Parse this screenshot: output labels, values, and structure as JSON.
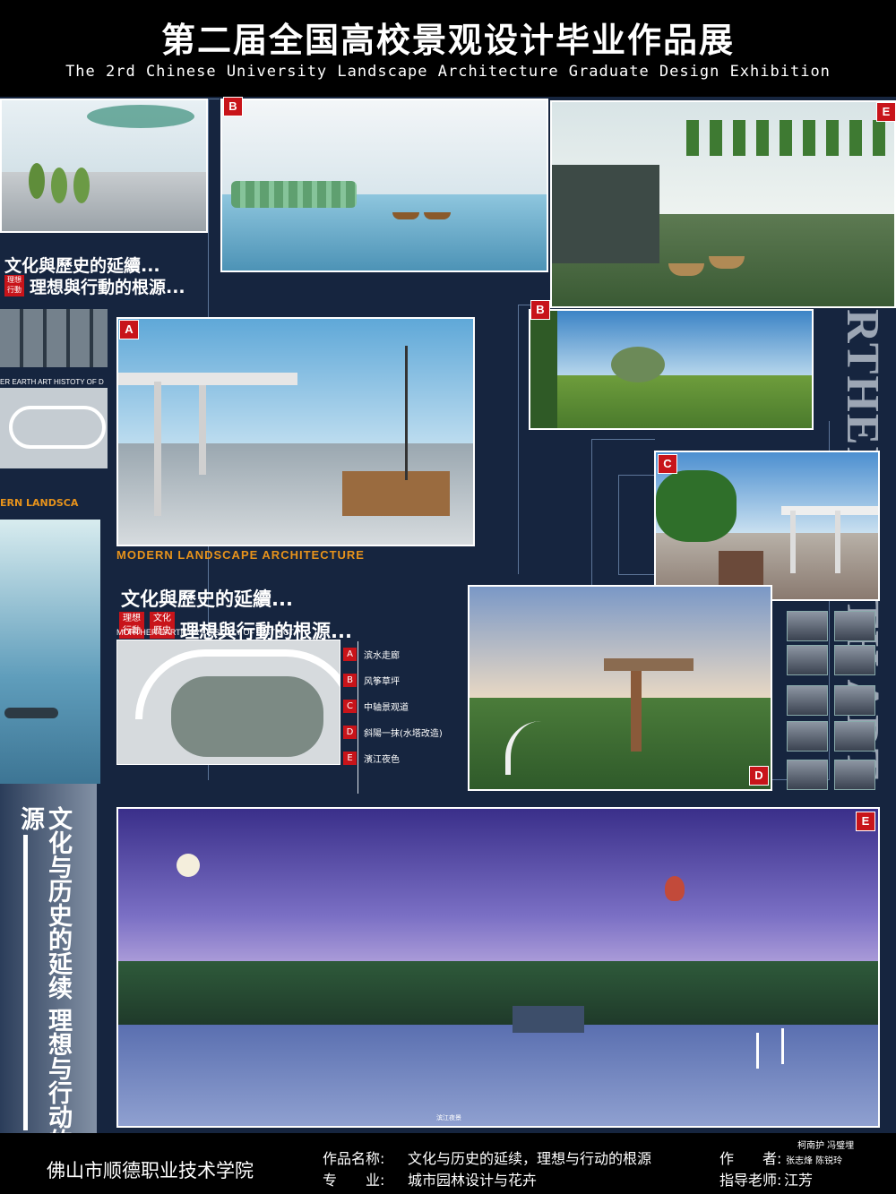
{
  "header": {
    "title_cn": "第二届全国高校景观设计毕业作品展",
    "title_en": "The 2rd Chinese University Landscape Architecture Graduate Design Exhibition"
  },
  "tags": {
    "a": "A",
    "b": "B",
    "c": "C",
    "d": "D",
    "e": "E",
    "top_b": "B",
    "top_e": "E"
  },
  "captions": {
    "top_line1": "文化與歷史的延續...",
    "top_line2": "理想與行動的根源...",
    "top_badge": "理想\n行動",
    "mid_line1": "文化與歷史的延續...",
    "mid_line2": "理想與行動的根源...",
    "mid_badge1": "理想\n行動",
    "mid_badge2": "文化\n歷史",
    "modern_label": "MODERN LANDSCAPE ARCHITECTURE",
    "modern_label_left": "ERN LANDSCA",
    "map_heading": "MORTHER EARTH ART  HISTOTY OF DISTRICT",
    "left_map_heading": "ER EARTH ART  HISTOTY OF D",
    "vertical_en": "RTHER EARTH ART HISTOTY OF DISTRICT",
    "sidebar_vertical": "文化与历史的延续 理想与行动的根源",
    "night_caption": "滨江夜景"
  },
  "legend": [
    {
      "tag": "A",
      "label": "滨水走廊"
    },
    {
      "tag": "B",
      "label": "风筝草坪"
    },
    {
      "tag": "C",
      "label": "中轴景观道"
    },
    {
      "tag": "D",
      "label": "斜陽一抹(水塔改造)"
    },
    {
      "tag": "E",
      "label": "濱江夜色"
    }
  ],
  "footer": {
    "school": "佛山市顺德职业技术学院",
    "work_label": "作品名称:",
    "work_name": "文化与历史的延续，理想与行动的根源",
    "major_label": "专　　业:",
    "major_name": "城市园林设计与花卉",
    "author_label": "作　　者:",
    "authors_line1": "柯南护  冯璧埋",
    "authors_line2": "张志烽  陈锐玲",
    "advisor_label": "指导老师:",
    "advisor_name": "江芳"
  },
  "colors": {
    "background": "#16253f",
    "tag_red": "#c8141a",
    "label_orange": "#e8931b"
  }
}
